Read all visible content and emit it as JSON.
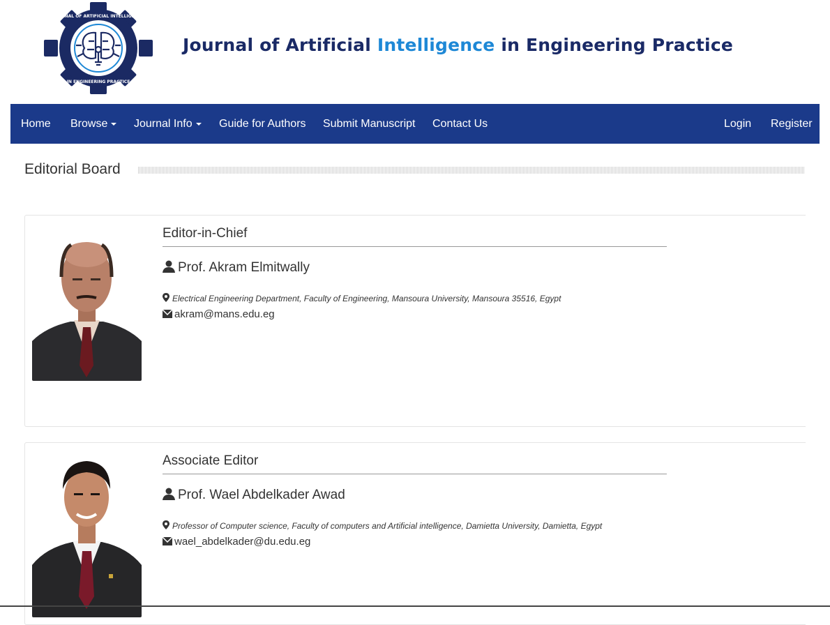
{
  "header": {
    "title_part1": "Journal of Artificial ",
    "title_accent": "Intelligence",
    "title_part2": " in Engineering Practice",
    "colors": {
      "title": "#1a2a66",
      "accent": "#1e88d6"
    }
  },
  "navbar": {
    "color": "#1b3a8a",
    "items": [
      {
        "label": "Home"
      },
      {
        "label": "Browse",
        "dropdown": true
      },
      {
        "label": "Journal Info",
        "dropdown": true
      },
      {
        "label": "Guide for Authors"
      },
      {
        "label": "Submit Manuscript"
      },
      {
        "label": "Contact Us"
      }
    ],
    "right_items": [
      {
        "label": "Login"
      },
      {
        "label": "Register"
      }
    ]
  },
  "page": {
    "title": "Editorial Board"
  },
  "editors": [
    {
      "role": "Editor-in-Chief",
      "name": "Prof. Akram Elmitwally",
      "affiliation": "Electrical Engineering Department, Faculty of Engineering, Mansoura University, Mansoura 35516, Egypt",
      "email": "akram@mans.edu.eg",
      "icons": [
        "user-icon",
        "map-marker-icon",
        "envelope-icon"
      ]
    },
    {
      "role": "Associate Editor",
      "name": "Prof. Wael Abdelkader Awad",
      "affiliation": "Professor of Computer science, Faculty of computers and Artificial intelligence, Damietta University, Damietta, Egypt",
      "email": "wael_abdelkader@du.edu.eg",
      "icons": [
        "user-icon",
        "map-marker-icon",
        "envelope-icon"
      ]
    }
  ]
}
